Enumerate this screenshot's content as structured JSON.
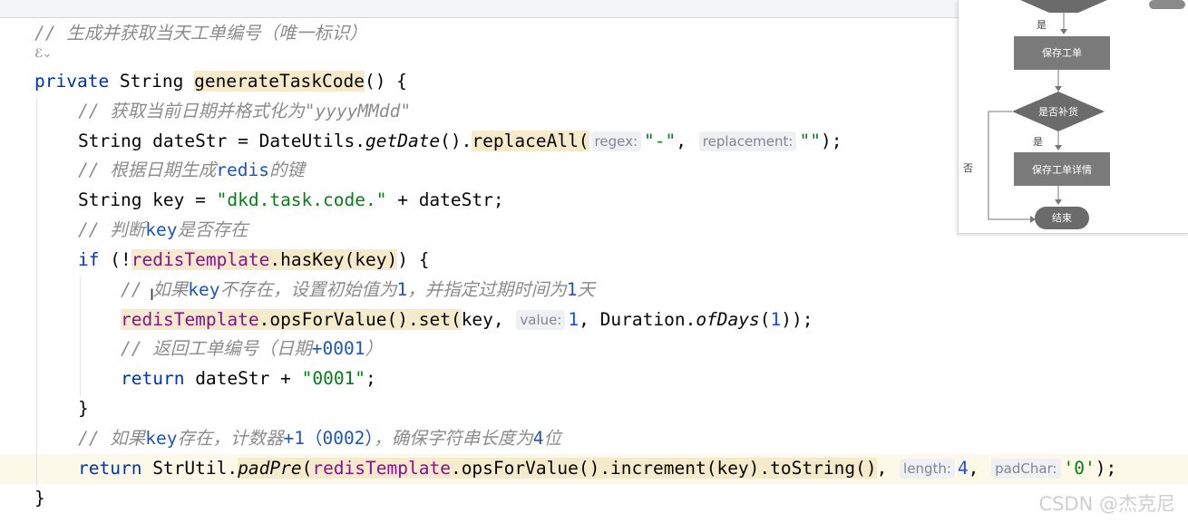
{
  "editor": {
    "lines": [
      [
        {
          "t": "// 生成并获取当天工单编号（唯一标识）",
          "c": "cmt"
        }
      ],
      [
        {
          "t": "private",
          "c": "kw"
        },
        {
          "t": " String "
        },
        {
          "t": "generateTaskCode",
          "c": "mark"
        },
        {
          "t": "() {"
        }
      ],
      [
        {
          "t": "// 获取当前日期并格式化为\"yyyyMMdd\"",
          "c": "cmt"
        }
      ],
      [
        {
          "t": "String dateStr = DateUtils."
        },
        {
          "t": "getDate",
          "c": "ital"
        },
        {
          "t": "()."
        },
        {
          "t": "replaceAll(",
          "c": "mark"
        },
        {
          "h": "regex:"
        },
        {
          "t": "\"-\"",
          "c": "str"
        },
        {
          "t": ", "
        },
        {
          "h": "replacement:"
        },
        {
          "t": "\"\"",
          "c": "str"
        },
        {
          "t": ");"
        }
      ],
      [
        {
          "t": "// 根据日期生成",
          "c": "cmt"
        },
        {
          "t": "redis",
          "c": "cmtkw"
        },
        {
          "t": "的键",
          "c": "cmt"
        }
      ],
      [
        {
          "t": "String key = "
        },
        {
          "t": "\"dkd.task.code.\"",
          "c": "str"
        },
        {
          "t": " + dateStr;"
        }
      ],
      [
        {
          "t": "// 判断",
          "c": "cmt"
        },
        {
          "t": "key",
          "c": "cmtkw"
        },
        {
          "t": "是否存在",
          "c": "cmt"
        }
      ],
      [
        {
          "t": "if",
          "c": "kw"
        },
        {
          "t": " (!"
        },
        {
          "t": "redisTemplate.hasKey(key)",
          "c": "fldmark"
        },
        {
          "t": ") {"
        }
      ],
      [
        {
          "t": "// 如果",
          "c": "cmt"
        },
        {
          "t": "key",
          "c": "cmtkw"
        },
        {
          "t": "不存在，设置初始值为",
          "c": "cmt"
        },
        {
          "t": "1",
          "c": "cmtkw"
        },
        {
          "t": "，并指定过期时间为",
          "c": "cmt"
        },
        {
          "t": "1",
          "c": "cmtkw"
        },
        {
          "t": "天",
          "c": "cmt"
        }
      ],
      [
        {
          "t": "redisTemplate.opsForValue().set(",
          "c": "fldmark2"
        },
        {
          "t": "key, "
        },
        {
          "h": "value:"
        },
        {
          "t": "1",
          "c": "num"
        },
        {
          "t": ", Duration."
        },
        {
          "t": "ofDays",
          "c": "ital"
        },
        {
          "t": "("
        },
        {
          "t": "1",
          "c": "num"
        },
        {
          "t": "));"
        }
      ],
      [
        {
          "t": "// 返回工单编号（日期",
          "c": "cmt"
        },
        {
          "t": "+0001",
          "c": "cmtkw"
        },
        {
          "t": "）",
          "c": "cmt"
        }
      ],
      [
        {
          "t": "return",
          "c": "kw"
        },
        {
          "t": " dateStr + "
        },
        {
          "t": "\"0001\"",
          "c": "str"
        },
        {
          "t": ";"
        }
      ],
      [
        {
          "t": "}"
        }
      ],
      [
        {
          "t": "// 如果",
          "c": "cmt"
        },
        {
          "t": "key",
          "c": "cmtkw"
        },
        {
          "t": "存在，计数器",
          "c": "cmt"
        },
        {
          "t": "+1（0002）",
          "c": "cmtkw"
        },
        {
          "t": "，确保字符串长度为",
          "c": "cmt"
        },
        {
          "t": "4",
          "c": "cmtkw"
        },
        {
          "t": "位",
          "c": "cmt"
        }
      ],
      [
        {
          "t": "return",
          "c": "kw"
        },
        {
          "t": " StrUtil."
        },
        {
          "t": "padPre",
          "c": "italmark"
        },
        {
          "t": "(redisTemplate.opsForValue().increment(key).toString()",
          "c": "mark3"
        },
        {
          "t": ", "
        },
        {
          "h": "length:"
        },
        {
          "t": "4",
          "c": "num"
        },
        {
          "t": ", "
        },
        {
          "h": "padChar:"
        },
        {
          "t": "'0'",
          "c": "str"
        },
        {
          "t": ");"
        }
      ],
      [
        {
          "t": "}"
        }
      ]
    ]
  },
  "flowchart": {
    "nodes": {
      "save_order": "保存工单",
      "decision": "是否补货",
      "save_detail": "保存工单详情",
      "end": "结束"
    },
    "labels": {
      "yes_top": "是",
      "yes_mid": "是",
      "no": "否"
    }
  },
  "watermark": "CSDN @杰克尼",
  "colors": {
    "keyword": "#0033b3",
    "string": "#067d17",
    "comment": "#8c8c8c",
    "field": "#871094",
    "number": "#1750eb",
    "highlight": "#f5eacb"
  }
}
